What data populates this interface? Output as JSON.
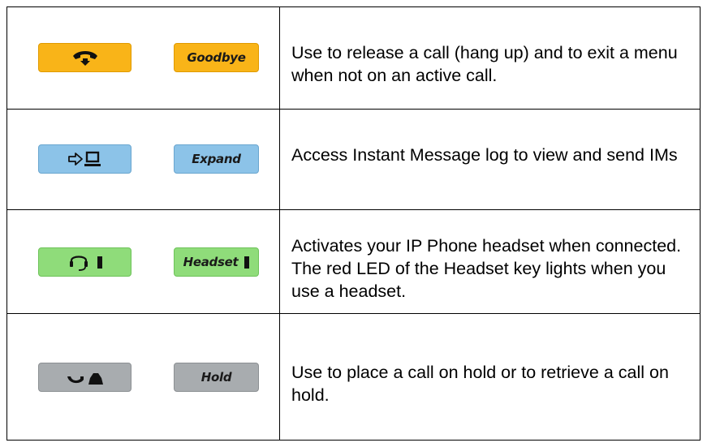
{
  "rows": [
    {
      "icon": "handset-down-icon",
      "key_label": "Goodbye",
      "key_color": "#f9b418",
      "description": "Use to release a call (hang up) and to exit a menu when not on an active call."
    },
    {
      "icon": "arrow-to-computer-icon",
      "key_label": "Expand",
      "key_color": "#8cc3e8",
      "description": "Access Instant Message log to view and send IMs"
    },
    {
      "icon": "headset-icon",
      "key_label": "Headset",
      "key_color": "#8fdc7a",
      "description": "Activates your IP Phone headset when connected. The red LED of the Headset key lights when you use a headset."
    },
    {
      "icon": "hold-handset-icon",
      "key_label": "Hold",
      "key_color": "#a8acaf",
      "description": "Use to place a call on hold or to retrieve a call on hold."
    }
  ]
}
